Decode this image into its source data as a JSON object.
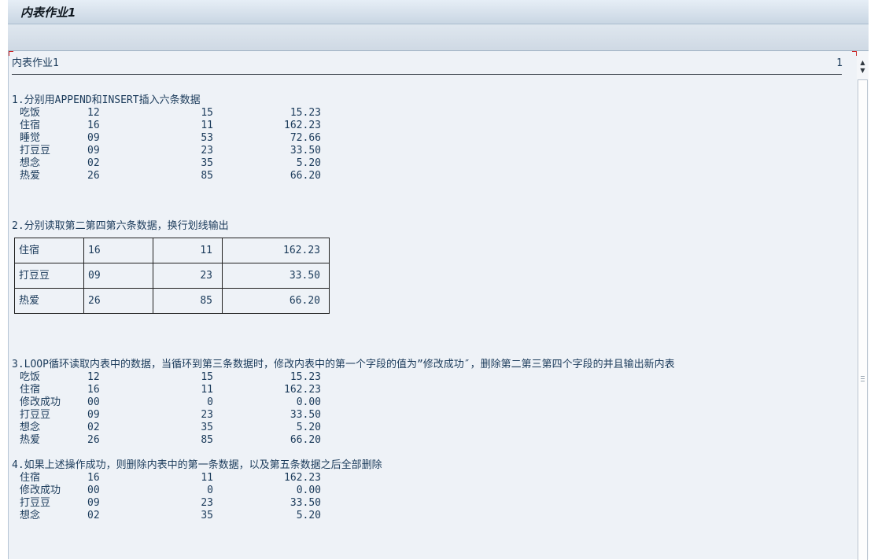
{
  "window": {
    "title": "内表作业1"
  },
  "list_header": {
    "title": "内表作业1",
    "page_number": "1"
  },
  "section1": {
    "heading": "1.分别用APPEND和INSERT插入六条数据",
    "rows": [
      [
        "吃饭",
        "12",
        "15",
        "15.23"
      ],
      [
        "住宿",
        "16",
        "11",
        "162.23"
      ],
      [
        "睡觉",
        "09",
        "53",
        "72.66"
      ],
      [
        "打豆豆",
        "09",
        "23",
        "33.50"
      ],
      [
        "想念",
        "02",
        "35",
        "5.20"
      ],
      [
        "热爱",
        "26",
        "85",
        "66.20"
      ]
    ]
  },
  "section2": {
    "heading": "2.分别读取第二第四第六条数据，换行划线输出",
    "rows": [
      [
        "住宿",
        "16",
        "11",
        "162.23"
      ],
      [
        "打豆豆",
        "09",
        "23",
        "33.50"
      ],
      [
        "热爱",
        "26",
        "85",
        "66.20"
      ]
    ]
  },
  "section3": {
    "heading": "3.LOOP循环读取内表中的数据，当循环到第三条数据时，修改内表中的第一个字段的值为”修改成功″，删除第二第三第四个字段的并且输出新内表",
    "rows": [
      [
        "吃饭",
        "12",
        "15",
        "15.23"
      ],
      [
        "住宿",
        "16",
        "11",
        "162.23"
      ],
      [
        "修改成功",
        "00",
        "0",
        "0.00"
      ],
      [
        "打豆豆",
        "09",
        "23",
        "33.50"
      ],
      [
        "想念",
        "02",
        "35",
        "5.20"
      ],
      [
        "热爱",
        "26",
        "85",
        "66.20"
      ]
    ]
  },
  "section4": {
    "heading": "4.如果上述操作成功，则删除内表中的第一条数据，以及第五条数据之后全部删除",
    "rows": [
      [
        "住宿",
        "16",
        "11",
        "162.23"
      ],
      [
        "修改成功",
        "00",
        "0",
        "0.00"
      ],
      [
        "打豆豆",
        "09",
        "23",
        "33.50"
      ],
      [
        "想念",
        "02",
        "35",
        "5.20"
      ]
    ]
  }
}
